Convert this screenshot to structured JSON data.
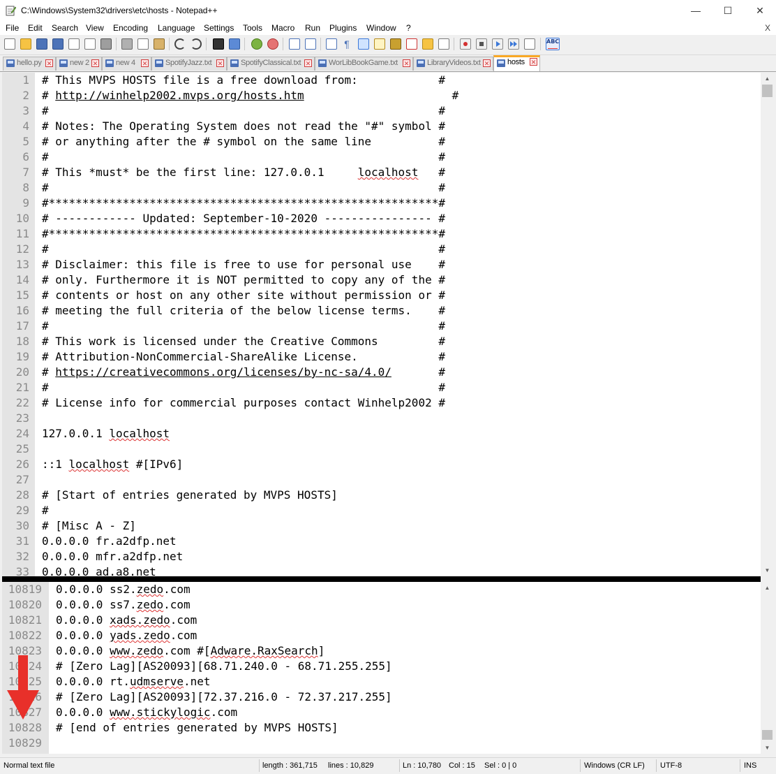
{
  "window": {
    "title": "C:\\Windows\\System32\\drivers\\etc\\hosts - Notepad++",
    "minimize": "—",
    "maximize": "☐",
    "close": "✕"
  },
  "menu": {
    "items": [
      "File",
      "Edit",
      "Search",
      "View",
      "Encoding",
      "Language",
      "Settings",
      "Tools",
      "Macro",
      "Run",
      "Plugins",
      "Window",
      "?"
    ],
    "close_doc": "X"
  },
  "tabs": [
    {
      "label": "hello.py",
      "active": false
    },
    {
      "label": "new 2",
      "active": false
    },
    {
      "label": "new 4",
      "active": false
    },
    {
      "label": "SpotifyJazz.txt",
      "active": false
    },
    {
      "label": "SpotifyClassical.txt",
      "active": false
    },
    {
      "label": "WorLibBookGame.txt",
      "active": false
    },
    {
      "label": "LibraryVideos.txt",
      "active": false
    },
    {
      "label": "hosts",
      "active": true
    }
  ],
  "editor": {
    "top_lines": [
      {
        "n": "1",
        "parts": [
          [
            "t",
            "# This MVPS HOSTS file is a free download from:            #"
          ]
        ]
      },
      {
        "n": "2",
        "parts": [
          [
            "t",
            "# "
          ],
          [
            "u",
            "http://winhelp2002.mvps.org/hosts.htm"
          ],
          [
            "t",
            "                      #"
          ]
        ]
      },
      {
        "n": "3",
        "parts": [
          [
            "t",
            "#                                                          #"
          ]
        ]
      },
      {
        "n": "4",
        "parts": [
          [
            "t",
            "# Notes: The Operating System does not read the \"#\" symbol #"
          ]
        ]
      },
      {
        "n": "5",
        "parts": [
          [
            "t",
            "# or anything after the # symbol on the same line          #"
          ]
        ]
      },
      {
        "n": "6",
        "parts": [
          [
            "t",
            "#                                                          #"
          ]
        ]
      },
      {
        "n": "7",
        "parts": [
          [
            "t",
            "# This *must* be the first line: 127.0.0.1     "
          ],
          [
            "s",
            "localhost"
          ],
          [
            "t",
            "   #"
          ]
        ]
      },
      {
        "n": "8",
        "parts": [
          [
            "t",
            "#                                                          #"
          ]
        ]
      },
      {
        "n": "9",
        "parts": [
          [
            "t",
            "#**********************************************************#"
          ]
        ]
      },
      {
        "n": "10",
        "parts": [
          [
            "t",
            "# ------------ Updated: September-10-2020 ---------------- #"
          ]
        ]
      },
      {
        "n": "11",
        "parts": [
          [
            "t",
            "#**********************************************************#"
          ]
        ]
      },
      {
        "n": "12",
        "parts": [
          [
            "t",
            "#                                                          #"
          ]
        ]
      },
      {
        "n": "13",
        "parts": [
          [
            "t",
            "# Disclaimer: this file is free to use for personal use    #"
          ]
        ]
      },
      {
        "n": "14",
        "parts": [
          [
            "t",
            "# only. Furthermore it is NOT permitted to copy any of the #"
          ]
        ]
      },
      {
        "n": "15",
        "parts": [
          [
            "t",
            "# contents or host on any other site without permission or #"
          ]
        ]
      },
      {
        "n": "16",
        "parts": [
          [
            "t",
            "# meeting the full criteria of the below license terms.    #"
          ]
        ]
      },
      {
        "n": "17",
        "parts": [
          [
            "t",
            "#                                                          #"
          ]
        ]
      },
      {
        "n": "18",
        "parts": [
          [
            "t",
            "# This work is licensed under the Creative Commons         #"
          ]
        ]
      },
      {
        "n": "19",
        "parts": [
          [
            "t",
            "# Attribution-NonCommercial-ShareAlike License.            #"
          ]
        ]
      },
      {
        "n": "20",
        "parts": [
          [
            "t",
            "# "
          ],
          [
            "u",
            "https://creativecommons.org/licenses/by-nc-sa/4.0/"
          ],
          [
            "t",
            "       #"
          ]
        ]
      },
      {
        "n": "21",
        "parts": [
          [
            "t",
            "#                                                          #"
          ]
        ]
      },
      {
        "n": "22",
        "parts": [
          [
            "t",
            "# License info for commercial purposes contact Winhelp2002 #"
          ]
        ]
      },
      {
        "n": "23",
        "parts": []
      },
      {
        "n": "24",
        "parts": [
          [
            "t",
            "127.0.0.1 "
          ],
          [
            "s",
            "localhost"
          ]
        ]
      },
      {
        "n": "25",
        "parts": []
      },
      {
        "n": "26",
        "parts": [
          [
            "t",
            "::1 "
          ],
          [
            "s",
            "localhost"
          ],
          [
            "t",
            " #[IPv6]"
          ]
        ]
      },
      {
        "n": "27",
        "parts": []
      },
      {
        "n": "28",
        "parts": [
          [
            "t",
            "# [Start of entries generated by MVPS HOSTS]"
          ]
        ]
      },
      {
        "n": "29",
        "parts": [
          [
            "t",
            "#"
          ]
        ]
      },
      {
        "n": "30",
        "parts": [
          [
            "t",
            "# [Misc A - Z]"
          ]
        ]
      },
      {
        "n": "31",
        "parts": [
          [
            "t",
            "0.0.0.0 fr.a2dfp.net"
          ]
        ]
      },
      {
        "n": "32",
        "parts": [
          [
            "t",
            "0.0.0.0 mfr.a2dfp.net"
          ]
        ]
      },
      {
        "n": "33",
        "parts": [
          [
            "t",
            "0.0.0.0 ad.a8.net"
          ]
        ]
      }
    ],
    "bottom_lines": [
      {
        "n": "10819",
        "parts": [
          [
            "t",
            "0.0.0.0 ss2."
          ],
          [
            "s",
            "zedo"
          ],
          [
            "t",
            ".com"
          ]
        ]
      },
      {
        "n": "10820",
        "parts": [
          [
            "t",
            "0.0.0.0 ss7."
          ],
          [
            "s",
            "zedo"
          ],
          [
            "t",
            ".com"
          ]
        ]
      },
      {
        "n": "10821",
        "parts": [
          [
            "t",
            "0.0.0.0 "
          ],
          [
            "s",
            "xads.zedo"
          ],
          [
            "t",
            ".com"
          ]
        ]
      },
      {
        "n": "10822",
        "parts": [
          [
            "t",
            "0.0.0.0 "
          ],
          [
            "s",
            "yads.zedo"
          ],
          [
            "t",
            ".com"
          ]
        ]
      },
      {
        "n": "10823",
        "parts": [
          [
            "t",
            "0.0.0.0 "
          ],
          [
            "s",
            "www.zedo"
          ],
          [
            "t",
            ".com #["
          ],
          [
            "s",
            "Adware.RaxSearch"
          ],
          [
            "t",
            "]"
          ]
        ]
      },
      {
        "n": "10824",
        "parts": [
          [
            "t",
            "# [Zero Lag][AS20093][68.71.240.0 - 68.71.255.255]"
          ]
        ]
      },
      {
        "n": "10825",
        "parts": [
          [
            "t",
            "0.0.0.0 rt."
          ],
          [
            "s",
            "udmserve"
          ],
          [
            "t",
            ".net"
          ]
        ]
      },
      {
        "n": "10826",
        "parts": [
          [
            "t",
            "# [Zero Lag][AS20093][72.37.216.0 - 72.37.217.255]"
          ]
        ]
      },
      {
        "n": "10827",
        "parts": [
          [
            "t",
            "0.0.0.0 "
          ],
          [
            "s",
            "www.stickylogic"
          ],
          [
            "t",
            ".com"
          ]
        ]
      },
      {
        "n": "10828",
        "parts": [
          [
            "t",
            "# [end of entries generated by MVPS HOSTS]"
          ]
        ]
      },
      {
        "n": "10829",
        "parts": []
      }
    ]
  },
  "status": {
    "file_type": "Normal text file",
    "length": "length : 361,715",
    "lines": "lines : 10,829",
    "ln": "Ln : 10,780",
    "col": "Col : 15",
    "sel": "Sel : 0 | 0",
    "eol": "Windows (CR LF)",
    "encoding": "UTF-8",
    "mode": "INS"
  },
  "colors": {
    "red_arrow": "#e8302a",
    "tab_accent": "#f9a825"
  }
}
